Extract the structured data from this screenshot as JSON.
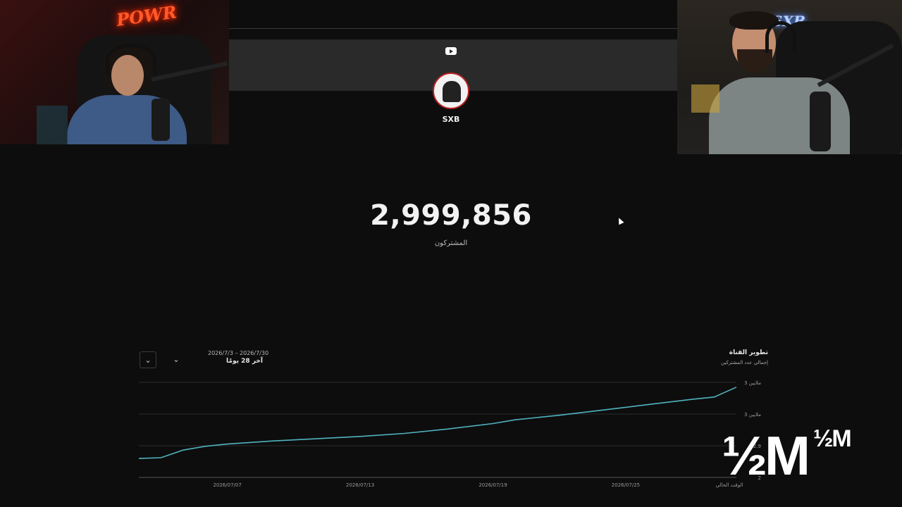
{
  "cams": {
    "left_neon": "POWR",
    "right_neon": "SXB"
  },
  "channel": {
    "name": "SXB",
    "platform_icon": "youtube-icon"
  },
  "subscribers": {
    "count": "2,999,856",
    "label": "المشتركون"
  },
  "chart_header": {
    "date_range": "2026/7/3 – 2026/7/30",
    "range_label": "آخر 28 يومًا",
    "title": "تطوير القناة",
    "subtitle": "إجمالي عدد المشتركين"
  },
  "chart_data": {
    "type": "line",
    "title": "تطوير القناة",
    "subtitle": "إجمالي عدد المشتركين",
    "x_ticks": [
      "2026/07/07",
      "2026/07/13",
      "2026/07/19",
      "2026/07/25",
      "الوقت الحالي"
    ],
    "y_ticks": [
      "3 ملايين",
      "3 ملايين",
      "2.9",
      "2"
    ],
    "series": [
      {
        "color": "#4fb3bf",
        "x": [
          "2026/07/03",
          "2026/07/04",
          "2026/07/05",
          "2026/07/06",
          "2026/07/07",
          "2026/07/09",
          "2026/07/11",
          "2026/07/13",
          "2026/07/15",
          "2026/07/17",
          "2026/07/19",
          "2026/07/20",
          "2026/07/22",
          "2026/07/24",
          "2026/07/26",
          "2026/07/28",
          "2026/07/29",
          "2026/07/30"
        ],
        "values": [
          2.905,
          2.906,
          2.916,
          2.921,
          2.924,
          2.928,
          2.931,
          2.934,
          2.938,
          2.944,
          2.951,
          2.956,
          2.962,
          2.969,
          2.976,
          2.983,
          2.986,
          2.999
        ]
      }
    ],
    "ylim": [
      2.88,
      3.01
    ],
    "grid": true
  },
  "overlay": {
    "big_text": "½M",
    "small_text": "½M"
  }
}
